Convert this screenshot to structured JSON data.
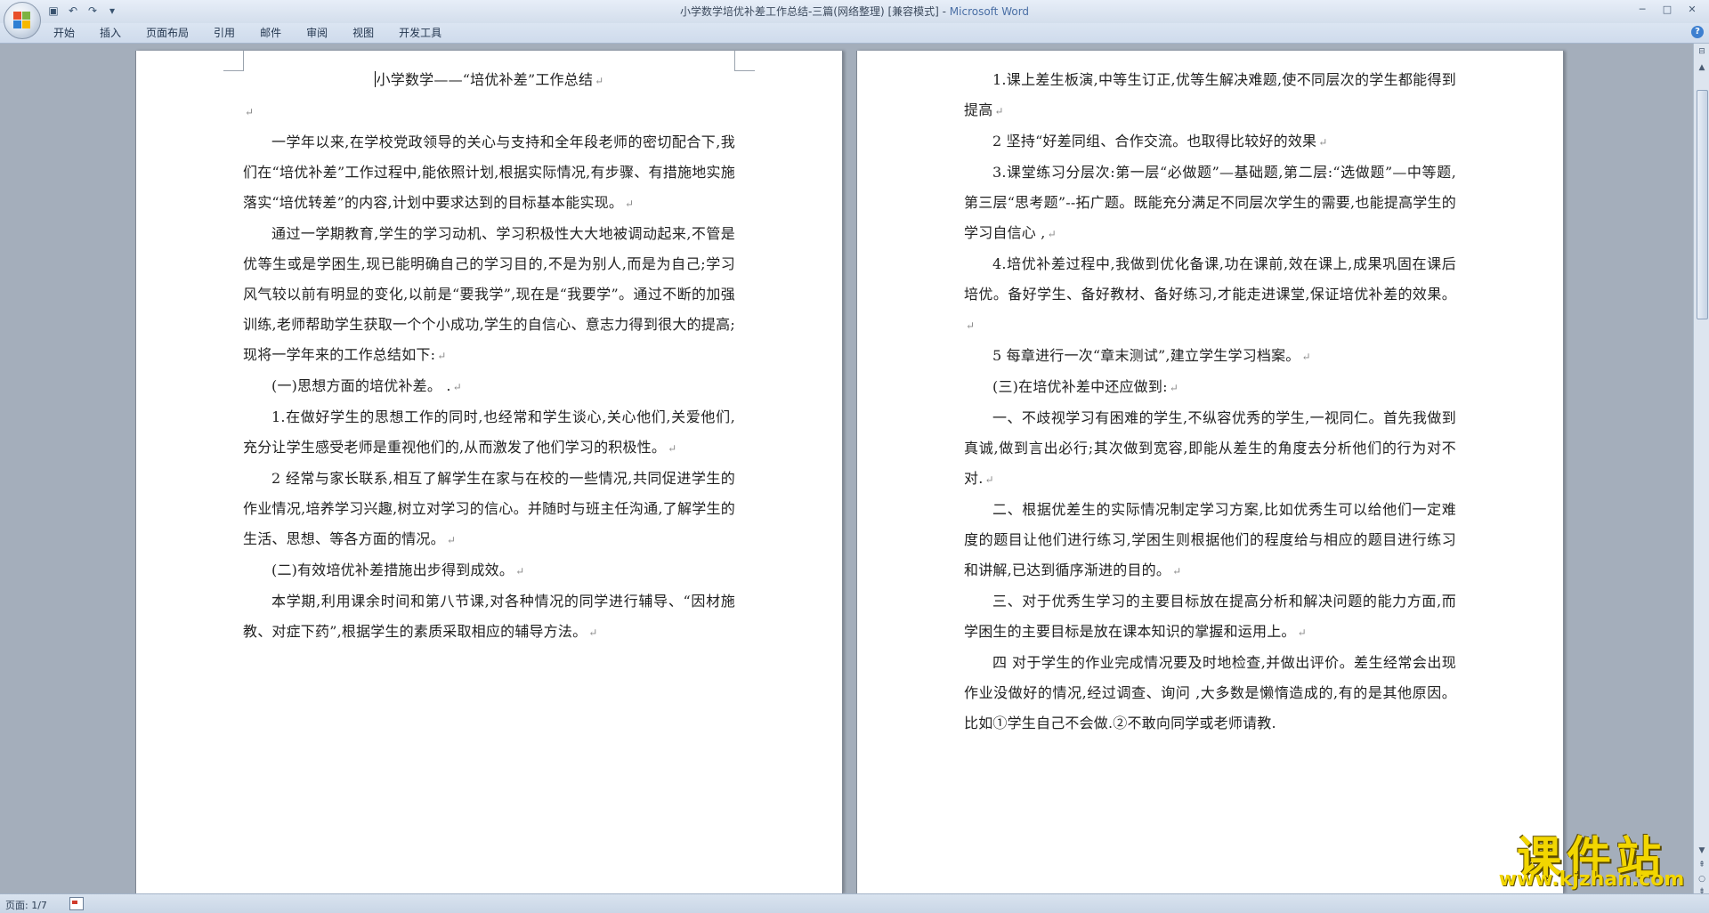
{
  "titlebar": {
    "document_title": "小学数学培优补差工作总结-三篇(网络整理) [兼容模式] - ",
    "app_name": "Microsoft Word",
    "minimize": "─",
    "maximize": "□",
    "close": "✕"
  },
  "quick_access": {
    "save_icon": "save-icon",
    "undo_icon": "undo-icon",
    "redo_icon": "redo-icon",
    "customize_icon": "dropdown-icon"
  },
  "ribbon": {
    "tabs": [
      "开始",
      "插入",
      "页面布局",
      "引用",
      "邮件",
      "审阅",
      "视图",
      "开发工具"
    ],
    "help": "?"
  },
  "page1": [
    {
      "cls": "title",
      "text": "小学数学——“培优补差”工作总结",
      "mark": "↵"
    },
    {
      "cls": "",
      "text": "",
      "mark": "↵"
    },
    {
      "cls": "indent",
      "text": "一学年以来,在学校党政领导的关心与支持和全年段老师的密切配合下,我们在“培优补差”工作过程中,能依照计划,根据实际情况,有步骤、有措施地实施落实“培优转差”的内容,计划中要求达到的目标基本能实现。",
      "mark": "↵"
    },
    {
      "cls": "indent",
      "text": "通过一学期教育,学生的学习动机、学习积极性大大地被调动起来,不管是优等生或是学困生,现已能明确自己的学习目的,不是为别人,而是为自己;学习风气较以前有明显的变化,以前是“要我学”,现在是“我要学”。通过不断的加强训练,老师帮助学生获取一个个小成功,学生的自信心、意志力得到很大的提高;现将一学年来的工作总结如下:",
      "mark": "↵"
    },
    {
      "cls": "indent",
      "text": "(一)思想方面的培优补差。 .",
      "mark": "↵"
    },
    {
      "cls": "indent",
      "text": "1.在做好学生的思想工作的同时,也经常和学生谈心,关心他们,关爱他们,充分让学生感受老师是重视他们的,从而激发了他们学习的积极性。",
      "mark": "↵"
    },
    {
      "cls": "indent",
      "text": "2 经常与家长联系,相互了解学生在家与在校的一些情况,共同促进学生的作业情况,培养学习兴趣,树立对学习的信心。并随时与班主任沟通,了解学生的生活、思想、等各方面的情况。",
      "mark": "↵"
    },
    {
      "cls": "indent",
      "text": "(二)有效培优补差措施出步得到成效。",
      "mark": "↵"
    },
    {
      "cls": "indent",
      "text": "本学期,利用课余时间和第八节课,对各种情况的同学进行辅导、“因材施教、对症下药”,根据学生的素质采取相应的辅导方法。",
      "mark": "↵"
    }
  ],
  "page2": [
    {
      "cls": "indent",
      "text": "1.课上差生板演,中等生订正,优等生解决难题,使不同层次的学生都能得到提高",
      "mark": "↵"
    },
    {
      "cls": "indent",
      "text": "2 坚持“好差同组、合作交流。也取得比较好的效果",
      "mark": "↵"
    },
    {
      "cls": "indent",
      "text": "3.课堂练习分层次:第一层“必做题”—基础题,第二层:“选做题”—中等题,第三层“思考题”--拓广题。既能充分满足不同层次学生的需要,也能提高学生的学习自信心 ,",
      "mark": "↵"
    },
    {
      "cls": "indent",
      "text": "4.培优补差过程中,我做到优化备课,功在课前,效在课上,成果巩固在课后培优。备好学生、备好教材、备好练习,才能走进课堂,保证培优补差的效果。",
      "mark": "↵"
    },
    {
      "cls": "indent",
      "text": "5 每章进行一次“章末测试”,建立学生学习档案。",
      "mark": "↵"
    },
    {
      "cls": "indent",
      "text": "(三)在培优补差中还应做到:",
      "mark": "↵"
    },
    {
      "cls": "indent",
      "text": "一、不歧视学习有困难的学生,不纵容优秀的学生,一视同仁。首先我做到真诚,做到言出必行;其次做到宽容,即能从差生的角度去分析他们的行为对不对.",
      "mark": "↵"
    },
    {
      "cls": "indent",
      "text": "二、根据优差生的实际情况制定学习方案,比如优秀生可以给他们一定难度的题目让他们进行练习,学困生则根据他们的程度给与相应的题目进行练习和讲解,已达到循序渐进的目的。",
      "mark": "↵"
    },
    {
      "cls": "indent",
      "text": "三、对于优秀生学习的主要目标放在提高分析和解决问题的能力方面,而学困生的主要目标是放在课本知识的掌握和运用上。",
      "mark": "↵"
    },
    {
      "cls": "indent",
      "text": "四 对于学生的作业完成情况要及时地检查,并做出评价。差生经常会出现作业没做好的情况,经过调查、询问 ,大多数是懒惰造成的,有的是其他原因。比如①学生自己不会做.②不敢向同学或老师请教.",
      "mark": ""
    }
  ],
  "statusbar": {
    "page_info": "页面: 1/7"
  },
  "watermark": {
    "main": "课件站",
    "url": "www.kjzhan.com"
  },
  "colors": {
    "brand_blue": "#4a6fa5",
    "watermark_yellow": "#f2d600"
  }
}
